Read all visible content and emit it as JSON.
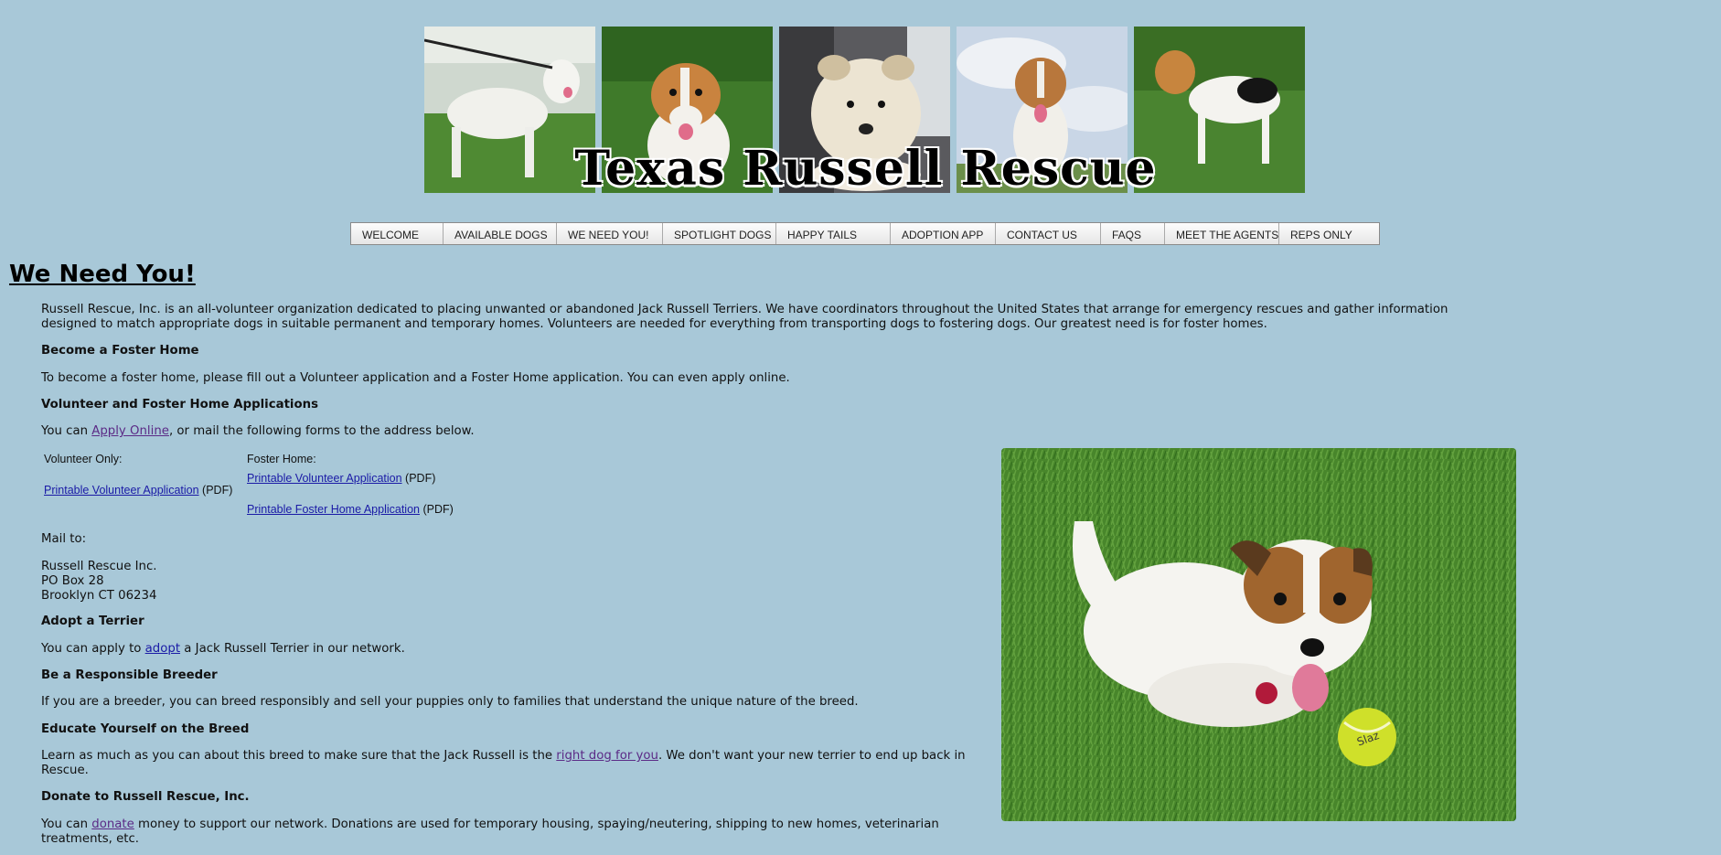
{
  "banner": {
    "title": "Texas Russell Rescue",
    "photos": [
      "dog-photo-1",
      "dog-photo-2",
      "dog-photo-3",
      "dog-photo-4",
      "dog-photo-5"
    ]
  },
  "nav": {
    "items": [
      "WELCOME",
      "AVAILABLE DOGS",
      "WE NEED YOU!",
      "SPOTLIGHT DOGS",
      "HAPPY TAILS",
      "ADOPTION APP",
      "CONTACT US",
      "FAQS",
      "MEET THE AGENTS",
      "REPS ONLY"
    ]
  },
  "page": {
    "title": "We Need You!",
    "intro": "Russell Rescue, Inc. is an all-volunteer organization dedicated to placing unwanted or abandoned Jack Russell Terriers. We have coordinators throughout the United States that arrange for emergency rescues and gather information designed to match appropriate dogs in suitable permanent and temporary homes. Volunteers are needed for everything from transporting dogs to fostering dogs. Our greatest need is for foster homes.",
    "foster": {
      "heading": "Become a Foster Home",
      "text": "To become a foster home, please fill out a Volunteer application and a Foster Home application. You can even apply online."
    },
    "applications": {
      "heading": "Volunteer and Foster Home Applications",
      "text_before": "You can ",
      "link": "Apply Online",
      "text_after": ", or mail the following forms to the address below.",
      "volunteer_label": "Volunteer Only:",
      "foster_label": "Foster Home:",
      "volunteer_link": "Printable Volunteer Application",
      "foster_volunteer_link": "Printable Volunteer Application",
      "foster_home_link": "Printable Foster Home Application",
      "pdf": "(PDF)"
    },
    "mail": {
      "label": "Mail to:",
      "line1": "Russell Rescue Inc.",
      "line2": "PO Box 28",
      "line3": "Brooklyn CT 06234"
    },
    "adopt": {
      "heading": "Adopt a Terrier",
      "text_before": "You can apply to ",
      "link": "adopt",
      "text_after": " a Jack Russell Terrier in our network."
    },
    "breeder": {
      "heading": "Be a Responsible Breeder",
      "text": "If you are a breeder, you can breed responsibly and sell your puppies only to families that understand the unique nature of the breed."
    },
    "educate": {
      "heading": "Educate Yourself on the Breed",
      "text_before": "Learn as much as you can about this breed to make sure that the Jack Russell is the ",
      "link": "right dog for you",
      "text_after": ". We don't want your new terrier to end up back in Rescue."
    },
    "donate": {
      "heading": "Donate to Russell Rescue, Inc.",
      "text_before": "You can ",
      "link": "donate",
      "text_after": " money to support our network. Donations are used for temporary housing, spaying/neutering, shipping to new homes, veterinarian treatments, etc."
    }
  },
  "colors": {
    "background": "#a8c8d8",
    "visited_link": "#5b2a86",
    "link": "#1a1aa6",
    "grass": "#4d8a2e"
  }
}
